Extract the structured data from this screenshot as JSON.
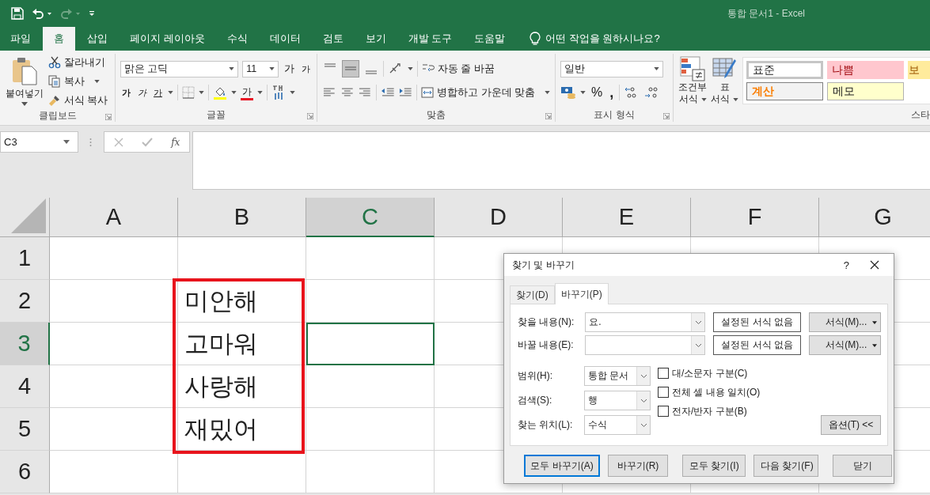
{
  "window": {
    "title": "통합 문서1  -  Excel"
  },
  "ribbon_tabs": [
    {
      "label": "파일",
      "selected": false
    },
    {
      "label": "홈",
      "selected": true
    },
    {
      "label": "삽입",
      "selected": false
    },
    {
      "label": "페이지 레이아웃",
      "selected": false
    },
    {
      "label": "수식",
      "selected": false
    },
    {
      "label": "데이터",
      "selected": false
    },
    {
      "label": "검토",
      "selected": false
    },
    {
      "label": "보기",
      "selected": false
    },
    {
      "label": "개발 도구",
      "selected": false
    },
    {
      "label": "도움말",
      "selected": false
    }
  ],
  "tell_me": "어떤 작업을 원하시나요?",
  "clipboard": {
    "paste": "붙여넣기",
    "cut": "잘라내기",
    "copy": "복사",
    "format_painter": "서식 복사",
    "label": "클립보드"
  },
  "font": {
    "name": "맑은 고딕",
    "size": "11",
    "grow": "가",
    "shrink": "가",
    "bold": "가",
    "italic": "가",
    "underline": "가",
    "font_color": "가",
    "label": "글꼴"
  },
  "alignment": {
    "wrap": "자동 줄 바꿈",
    "merge": "병합하고 가운데 맞춤",
    "label": "맞춤"
  },
  "number": {
    "format": "일반",
    "percent": "%",
    "comma": ",",
    "label": "표시 형식"
  },
  "styles": {
    "conditional": [
      "조건부",
      "서식"
    ],
    "table": [
      "표",
      "서식"
    ],
    "label": "스타",
    "cells": [
      {
        "label": "표준",
        "kind": "normal"
      },
      {
        "label": "나쁨",
        "kind": "bad"
      },
      {
        "label": "보",
        "kind": "neutral"
      },
      {
        "label": "계산",
        "kind": "calculation"
      },
      {
        "label": "메모",
        "kind": "note"
      }
    ]
  },
  "formula_bar": {
    "name_box": "C3",
    "fx": "fx"
  },
  "sheet": {
    "columns": [
      {
        "label": "A",
        "selected": false
      },
      {
        "label": "B",
        "selected": false
      },
      {
        "label": "C",
        "selected": true
      },
      {
        "label": "D",
        "selected": false
      },
      {
        "label": "E",
        "selected": false
      },
      {
        "label": "F",
        "selected": false
      },
      {
        "label": "G",
        "selected": false
      }
    ],
    "rows": [
      {
        "label": "1",
        "selected": false,
        "cells": [
          null,
          null,
          null,
          null,
          null,
          null,
          null
        ]
      },
      {
        "label": "2",
        "selected": false,
        "cells": [
          null,
          "미안해",
          null,
          null,
          null,
          null,
          null
        ]
      },
      {
        "label": "3",
        "selected": true,
        "cells": [
          null,
          "고마워",
          null,
          null,
          null,
          null,
          null
        ]
      },
      {
        "label": "4",
        "selected": false,
        "cells": [
          null,
          "사랑해",
          null,
          null,
          null,
          null,
          null
        ]
      },
      {
        "label": "5",
        "selected": false,
        "cells": [
          null,
          "재밌어",
          null,
          null,
          null,
          null,
          null
        ]
      },
      {
        "label": "6",
        "selected": false,
        "cells": [
          null,
          null,
          null,
          null,
          null,
          null,
          null
        ]
      }
    ]
  },
  "dialog": {
    "title": "찾기 및 바꾸기",
    "help": "?",
    "tabs": [
      {
        "label": "찾기(D)",
        "selected": false
      },
      {
        "label": "바꾸기(P)",
        "selected": true
      }
    ],
    "find": {
      "label": "찾을 내용(N):",
      "value": "요.",
      "format_status": "설정된 서식 없음",
      "format_button": "서식(M)..."
    },
    "replace": {
      "label": "바꿀 내용(E):",
      "format_status": "설정된 서식 없음",
      "format_button": "서식(M)..."
    },
    "options": [
      {
        "label": "범위(H):",
        "value": "통합 문서"
      },
      {
        "label": "검색(S):",
        "value": "행"
      },
      {
        "label": "찾는 위치(L):",
        "value": "수식"
      }
    ],
    "checkboxes": [
      {
        "label": "대/소문자 구분(C)",
        "checked": false
      },
      {
        "label": "전체 셀 내용 일치(O)",
        "checked": false
      },
      {
        "label": "전자/반자 구분(B)",
        "checked": false
      }
    ],
    "options_toggle": "옵션(T) <<",
    "buttons": [
      {
        "label": "모두 바꾸기(A)",
        "default": true
      },
      {
        "label": "바꾸기(R)",
        "default": false
      },
      {
        "label": "모두 찾기(I)",
        "default": false
      },
      {
        "label": "다음 찾기(F)",
        "default": false
      },
      {
        "label": "닫기",
        "default": false
      }
    ]
  }
}
